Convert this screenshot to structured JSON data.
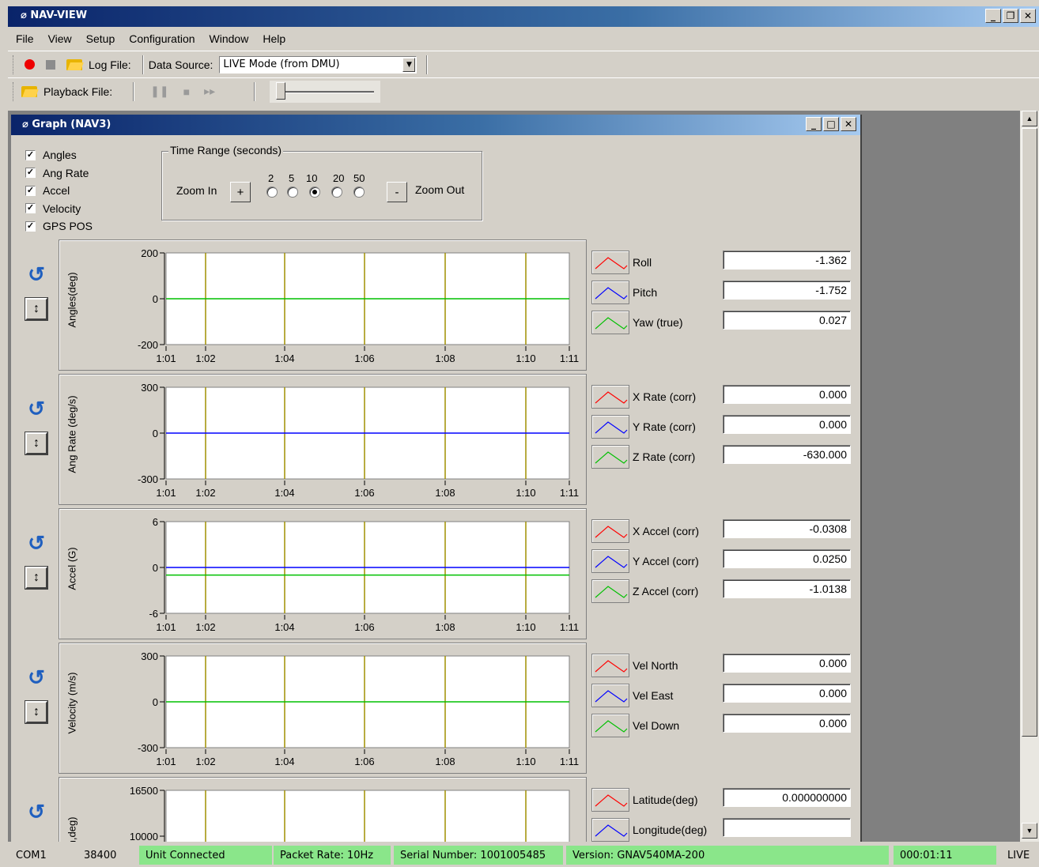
{
  "app": {
    "title": "NAV-VIEW"
  },
  "menu": [
    "File",
    "View",
    "Setup",
    "Configuration",
    "Window",
    "Help"
  ],
  "toolbar1": {
    "log_file_label": "Log File:",
    "data_source_label": "Data Source:",
    "data_source_value": "LIVE Mode (from DMU)"
  },
  "toolbar2": {
    "playback_label": "Playback File:"
  },
  "graph_window": {
    "title": "Graph (NAV3)",
    "checkboxes": [
      {
        "label": "Angles",
        "checked": true
      },
      {
        "label": "Ang Rate",
        "checked": true
      },
      {
        "label": "Accel",
        "checked": true
      },
      {
        "label": "Velocity",
        "checked": true
      },
      {
        "label": "GPS POS",
        "checked": true
      }
    ],
    "time_range": {
      "title": "Time Range (seconds)",
      "zoom_in": "Zoom In",
      "zoom_out": "Zoom Out",
      "plus": "+",
      "minus": "-",
      "options": [
        "2",
        "5",
        "10",
        "20",
        "50"
      ],
      "selected": "10"
    },
    "x_ticks": [
      "1:01",
      "1:02",
      "1:04",
      "1:06",
      "1:08",
      "1:10",
      "1:11"
    ],
    "panels": [
      {
        "ylabel": "Angles(deg)",
        "yticks": [
          "200",
          "0",
          "-200"
        ],
        "ylim": [
          -200,
          200
        ],
        "series": [
          {
            "name": "Roll",
            "value": "-1.362",
            "color": "#ff0000"
          },
          {
            "name": "Pitch",
            "value": "-1.752",
            "color": "#0000ff"
          },
          {
            "name": "Yaw (true)",
            "value": "0.027",
            "color": "#00c000"
          }
        ],
        "lines": [
          {
            "color": "#00c000",
            "y": 0
          }
        ]
      },
      {
        "ylabel": "Ang Rate (deg/s)",
        "yticks": [
          "300",
          "0",
          "-300"
        ],
        "ylim": [
          -300,
          300
        ],
        "series": [
          {
            "name": "X Rate (corr)",
            "value": "0.000",
            "color": "#ff0000"
          },
          {
            "name": "Y Rate (corr)",
            "value": "0.000",
            "color": "#0000ff"
          },
          {
            "name": "Z Rate (corr)",
            "value": "-630.000",
            "color": "#00c000"
          }
        ],
        "lines": [
          {
            "color": "#0000ff",
            "y": 0
          }
        ]
      },
      {
        "ylabel": "Accel (G)",
        "yticks": [
          "6",
          "0",
          "-6"
        ],
        "ylim": [
          -6,
          6
        ],
        "series": [
          {
            "name": "X Accel (corr)",
            "value": "-0.0308",
            "color": "#ff0000"
          },
          {
            "name": "Y Accel (corr)",
            "value": "0.0250",
            "color": "#0000ff"
          },
          {
            "name": "Z Accel (corr)",
            "value": "-1.0138",
            "color": "#00c000"
          }
        ],
        "lines": [
          {
            "color": "#0000ff",
            "y": 0
          },
          {
            "color": "#00c000",
            "y": -1
          }
        ]
      },
      {
        "ylabel": "Velocity (m/s)",
        "yticks": [
          "300",
          "0",
          "-300"
        ],
        "ylim": [
          -300,
          300
        ],
        "series": [
          {
            "name": "Vel North",
            "value": "0.000",
            "color": "#ff0000"
          },
          {
            "name": "Vel East",
            "value": "0.000",
            "color": "#0000ff"
          },
          {
            "name": "Vel Down",
            "value": "0.000",
            "color": "#00c000"
          }
        ],
        "lines": [
          {
            "color": "#00c000",
            "y": 0
          }
        ]
      },
      {
        "ylabel": "t (m,deg)",
        "yticks": [
          "16500",
          "10000"
        ],
        "ylim": [
          3500,
          16500
        ],
        "series": [
          {
            "name": "Latitude(deg)",
            "value": "0.000000000",
            "color": "#ff0000"
          },
          {
            "name": "Longitude(deg)",
            "value": "",
            "color": "#0000ff"
          }
        ],
        "lines": []
      }
    ]
  },
  "status": {
    "port": "COM1",
    "baud": "38400",
    "connection": "Unit Connected",
    "packet_rate": "Packet Rate: 10Hz",
    "serial": "Serial Number: 1001005485",
    "version": "Version: GNAV540MA-200",
    "elapsed": "000:01:11",
    "mode": "LIVE"
  },
  "colors": {
    "accent": "#0a246a",
    "status_green": "#8ae68a",
    "grid_line": "#a09000"
  }
}
